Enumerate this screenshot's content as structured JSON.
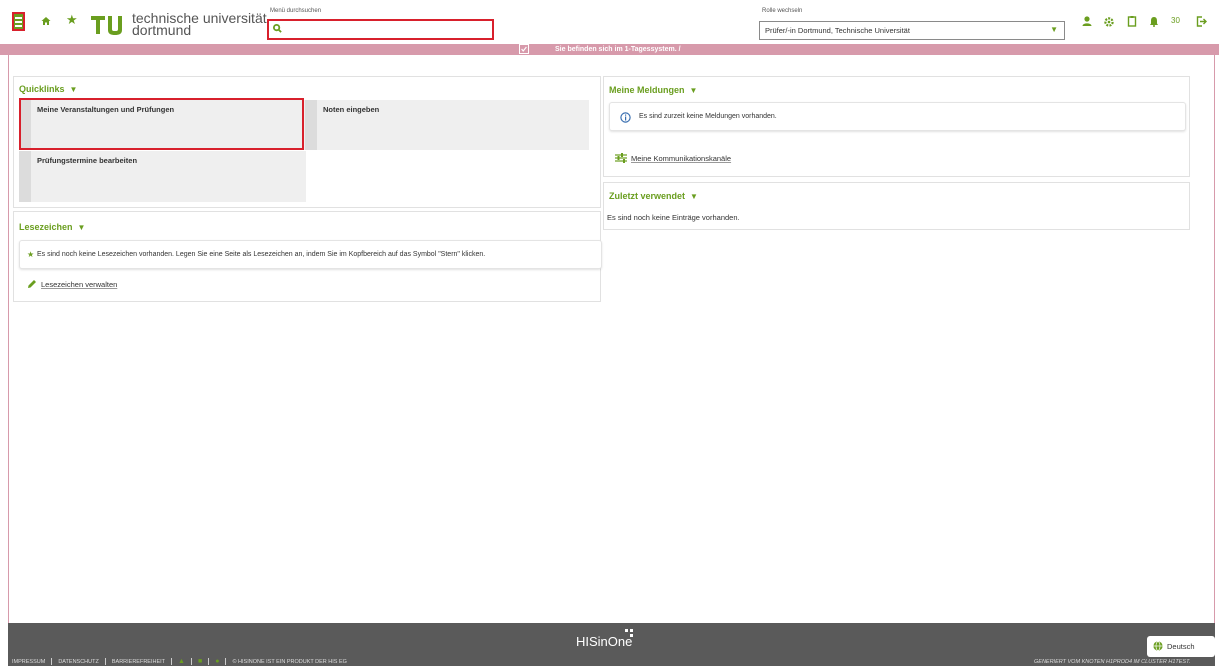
{
  "header": {
    "logo_line1": "technische universität",
    "logo_line2": "dortmund",
    "search_label": "Menü durchsuchen",
    "search_value": "",
    "role_label": "Rolle wechseln",
    "role_selected": "Prüfer/-in Dortmund, Technische Universität",
    "notification_count": "30",
    "accent_color": "#6a9e1f",
    "highlight_color": "#d8202c",
    "icons": [
      "menu-icon",
      "home-icon",
      "star-icon",
      "search-icon",
      "user-icon",
      "gear-icon",
      "clipboard-icon",
      "bell-icon",
      "logout-icon"
    ]
  },
  "banner": {
    "text": "Sie befinden sich im 1-Tagessystem. /",
    "color": "#d79aab"
  },
  "quicklinks": {
    "title": "Quicklinks",
    "items": [
      "Meine Veranstaltungen und Prüfungen",
      "Noten eingeben",
      "Prüfungstermine bearbeiten"
    ]
  },
  "bookmarks": {
    "title": "Lesezeichen",
    "empty_text": "Es sind noch keine Lesezeichen vorhanden. Legen Sie eine Seite als Lesezeichen an, indem Sie im Kopfbereich auf das Symbol \"Stern\" klicken.",
    "manage_link": "Lesezeichen verwalten"
  },
  "messages": {
    "title": "Meine Meldungen",
    "empty_text": "Es sind zurzeit keine Meldungen vorhanden.",
    "channels_link": "Meine Kommunikationskanäle"
  },
  "recent": {
    "title": "Zuletzt verwendet",
    "empty_text": "Es sind noch keine Einträge vorhanden."
  },
  "footer": {
    "brand": "HISinOne",
    "language": "Deutsch",
    "links": [
      "IMPRESSUM",
      "DATENSCHUTZ",
      "BARRIEREFREIHEIT"
    ],
    "copyright": "© HISINONE IST EIN PRODUKT DER HIS EG",
    "node_info": "GENERIERT VOM KNOTEN H1PROD4 IM CLUSTER H1TEST."
  }
}
